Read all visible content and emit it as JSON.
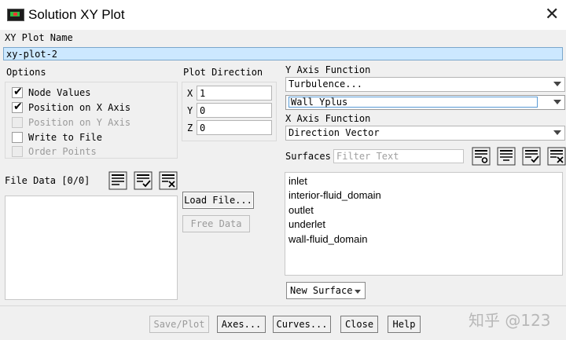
{
  "window": {
    "title": "Solution XY Plot",
    "icon": "app-icon",
    "close": "close-icon"
  },
  "plot_name": {
    "label": "XY Plot Name",
    "value": "xy-plot-2"
  },
  "options": {
    "label": "Options",
    "items": [
      {
        "label": "Node Values",
        "checked": true,
        "enabled": true
      },
      {
        "label": "Position on X Axis",
        "checked": true,
        "enabled": true
      },
      {
        "label": "Position on Y Axis",
        "checked": false,
        "enabled": false
      },
      {
        "label": "Write to File",
        "checked": false,
        "enabled": true
      },
      {
        "label": "Order Points",
        "checked": false,
        "enabled": false
      }
    ]
  },
  "plot_direction": {
    "label": "Plot Direction",
    "rows": [
      {
        "axis": "X",
        "value": "1"
      },
      {
        "axis": "Y",
        "value": "0"
      },
      {
        "axis": "Z",
        "value": "0"
      }
    ]
  },
  "y_axis_function": {
    "label": "Y Axis Function",
    "category": "Turbulence...",
    "quantity": "Wall Yplus"
  },
  "x_axis_function": {
    "label": "X Axis Function",
    "value": "Direction Vector"
  },
  "surfaces": {
    "label": "Surfaces",
    "filter_placeholder": "Filter Text",
    "items": [
      "inlet",
      "interior-fluid_domain",
      "outlet",
      "underlet",
      "wall-fluid_domain"
    ],
    "new_surface_label": "New Surface"
  },
  "file_data": {
    "label": "File Data [0/0]",
    "load_label": "Load File...",
    "free_label": "Free Data"
  },
  "buttons": {
    "save_plot": "Save/Plot",
    "axes": "Axes...",
    "curves": "Curves...",
    "close": "Close",
    "help": "Help"
  },
  "watermark": "知乎 @123"
}
